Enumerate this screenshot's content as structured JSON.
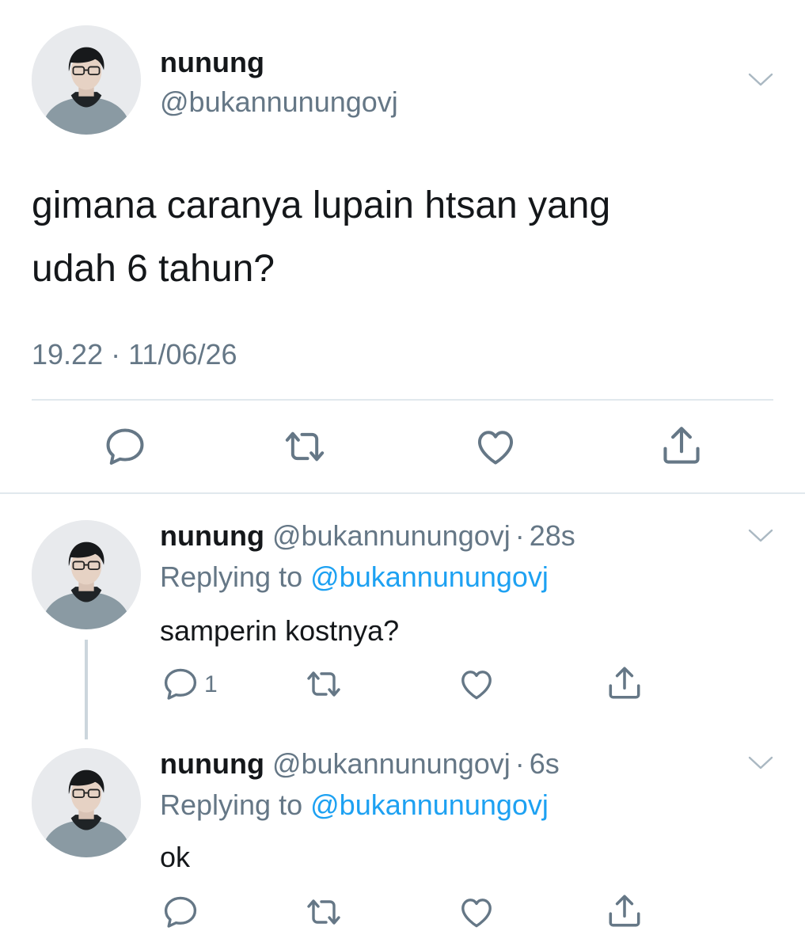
{
  "main_tweet": {
    "display_name": "nunung",
    "handle": "@bukannunungovj",
    "text_line1": "gimana caranya lupain htsan yang",
    "text_line2": "udah 6 tahun?",
    "timestamp": "19.22 · 11/06/26"
  },
  "replies": [
    {
      "display_name": "nunung",
      "handle": "@bukannunungovj",
      "separator": "·",
      "time": "28s",
      "replying_prefix": "Replying to",
      "replying_to": "@bukannunungovj",
      "text": "samperin kostnya?",
      "reply_count": "1"
    },
    {
      "display_name": "nunung",
      "handle": "@bukannunungovj",
      "separator": "·",
      "time": "6s",
      "replying_prefix": "Replying to",
      "replying_to": "@bukannunungovj",
      "text": "ok",
      "reply_count": ""
    }
  ],
  "icons": {
    "reply": "speech-bubble-icon",
    "retweet": "retweet-icon",
    "like": "heart-icon",
    "share": "share-icon",
    "menu": "chevron-down-icon"
  },
  "colors": {
    "text": "#14171a",
    "secondary": "#657786",
    "link": "#1da1f2",
    "icon": "#657786",
    "divider": "#e1e8ed"
  }
}
